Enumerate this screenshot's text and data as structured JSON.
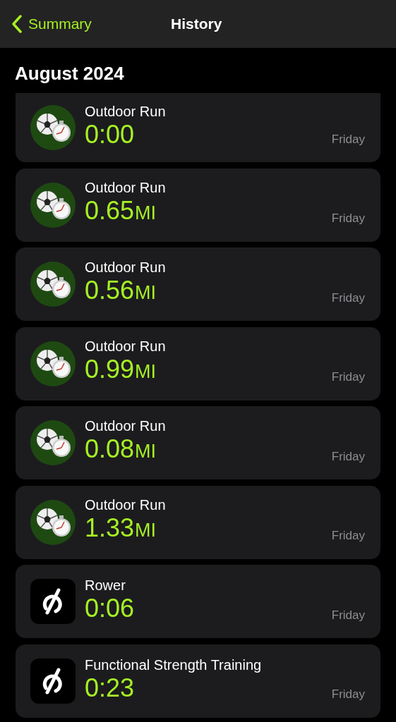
{
  "nav": {
    "back": "Summary",
    "title": "History"
  },
  "section": "August 2024",
  "workouts": [
    {
      "kind": "run",
      "name": "Outdoor Run",
      "value": "0:00",
      "day": "Friday"
    },
    {
      "kind": "run",
      "name": "Outdoor Run",
      "value": "0.65",
      "unit": "MI",
      "day": "Friday"
    },
    {
      "kind": "run",
      "name": "Outdoor Run",
      "value": "0.56",
      "unit": "MI",
      "day": "Friday"
    },
    {
      "kind": "run",
      "name": "Outdoor Run",
      "value": "0.99",
      "unit": "MI",
      "day": "Friday"
    },
    {
      "kind": "run",
      "name": "Outdoor Run",
      "value": "0.08",
      "unit": "MI",
      "day": "Friday"
    },
    {
      "kind": "run",
      "name": "Outdoor Run",
      "value": "1.33",
      "unit": "MI",
      "day": "Friday"
    },
    {
      "kind": "app",
      "name": "Rower",
      "value": "0:06",
      "day": "Friday"
    },
    {
      "kind": "app",
      "name": "Functional Strength Training",
      "value": "0:23",
      "day": "Friday"
    }
  ]
}
